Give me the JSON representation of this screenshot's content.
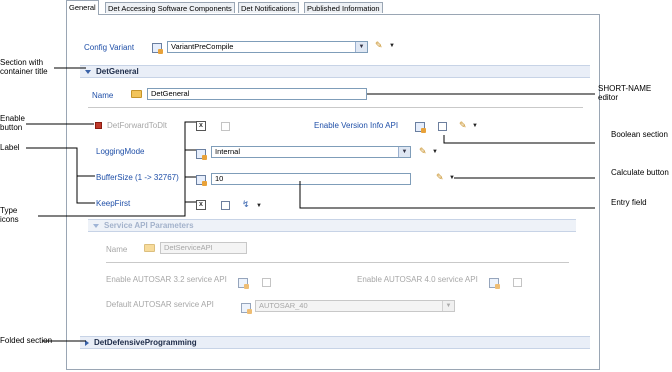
{
  "tabs": [
    {
      "label": "General",
      "active": true
    },
    {
      "label": "Det Accessing Software Components",
      "active": false
    },
    {
      "label": "Det Notifications",
      "active": false
    },
    {
      "label": "Published Information",
      "active": false
    }
  ],
  "config_variant": {
    "label": "Config Variant",
    "value": "VariantPreCompile"
  },
  "det_general": {
    "title": "DetGeneral",
    "name_label": "Name",
    "name_value": "DetGeneral",
    "forward_label": "DetForwardToDlt",
    "version_info_label": "Enable Version Info API",
    "logging_mode_label": "LoggingMode",
    "logging_mode_value": "Internal",
    "buffer_size_label": "BufferSize (1 -> 32767)",
    "buffer_size_value": "10",
    "keep_first_label": "KeepFirst"
  },
  "service_api": {
    "title": "Service API Parameters",
    "name_label": "Name",
    "name_value": "DetServiceAPI",
    "autosar32_label": "Enable AUTOSAR 3.2 service API",
    "autosar40_label": "Enable AUTOSAR 4.0 service API",
    "default_label": "Default AUTOSAR service API",
    "default_value": "AUTOSAR_40"
  },
  "defensive": {
    "title": "DetDefensiveProgramming"
  },
  "callouts": {
    "section_container": "Section with container title",
    "enable_button": "Enable button",
    "label": "Label",
    "type_icons": "Type icons",
    "folded_section": "Folded section",
    "short_name_editor": "SHORT-NAME editor",
    "boolean_section": "Boolean section",
    "calculate_button": "Calculate button",
    "entry_field": "Entry field"
  }
}
